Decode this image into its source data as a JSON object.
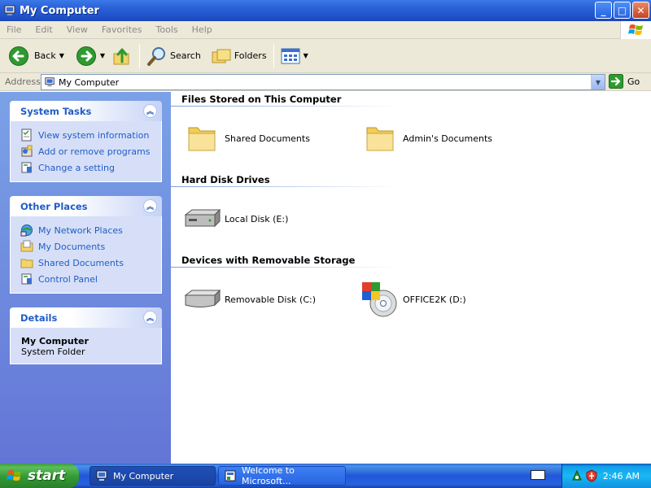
{
  "window": {
    "title": "My Computer",
    "buttons": {
      "minimize": "_",
      "maximize": "□",
      "close": "✕"
    }
  },
  "menu": [
    "File",
    "Edit",
    "View",
    "Favorites",
    "Tools",
    "Help"
  ],
  "toolbar": {
    "back": "Back",
    "search": "Search",
    "folders": "Folders"
  },
  "address": {
    "label": "Address",
    "value": "My Computer",
    "go": "Go"
  },
  "left_pane": {
    "system_tasks": {
      "title": "System Tasks",
      "items": [
        "View system information",
        "Add or remove programs",
        "Change a setting"
      ]
    },
    "other_places": {
      "title": "Other Places",
      "items": [
        "My Network Places",
        "My Documents",
        "Shared Documents",
        "Control Panel"
      ]
    },
    "details": {
      "title": "Details",
      "name": "My Computer",
      "type": "System Folder"
    }
  },
  "groups": {
    "files": {
      "title": "Files Stored on This Computer",
      "items": [
        "Shared Documents",
        "Admin's Documents"
      ]
    },
    "hard_disks": {
      "title": "Hard Disk Drives",
      "items": [
        "Local Disk (E:)"
      ]
    },
    "removable": {
      "title": "Devices with Removable Storage",
      "items": [
        "Removable Disk (C:)",
        "OFFICE2K (D:)"
      ]
    }
  },
  "taskbar": {
    "start": "start",
    "tasks": [
      "My Computer",
      "Welcome to Microsoft..."
    ],
    "clock": "2:46 AM"
  },
  "colors": {
    "titlebar": "#2a5fd6",
    "link": "#215dc6",
    "left_pane_top": "#7ba2e7",
    "left_pane_bottom": "#6375d6",
    "start_green": "#339933"
  },
  "icons": {
    "back": "back-arrow-icon",
    "forward": "forward-arrow-icon",
    "up": "up-folder-icon",
    "search": "magnifier-icon",
    "folders": "folders-icon",
    "views": "views-icon"
  }
}
